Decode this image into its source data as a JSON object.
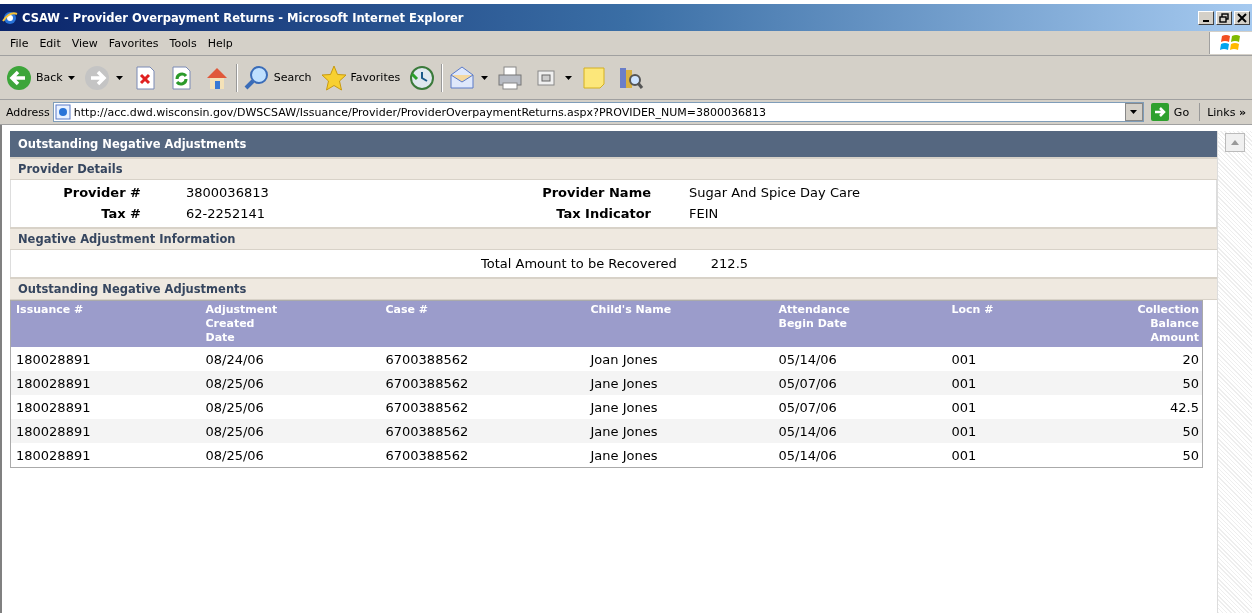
{
  "window": {
    "title": "CSAW - Provider Overpayment Returns - Microsoft Internet Explorer"
  },
  "menu": [
    "File",
    "Edit",
    "View",
    "Favorites",
    "Tools",
    "Help"
  ],
  "toolbar": [
    {
      "kind": "back",
      "label": "Back",
      "dropdown": true
    },
    {
      "kind": "forward",
      "dropdown": true
    },
    {
      "kind": "stop"
    },
    {
      "kind": "refresh"
    },
    {
      "kind": "home",
      "separator_after": true
    },
    {
      "kind": "search",
      "label": "Search"
    },
    {
      "kind": "favorites",
      "label": "Favorites"
    },
    {
      "kind": "history",
      "separator_after": true
    },
    {
      "kind": "mail",
      "dropdown": true
    },
    {
      "kind": "print"
    },
    {
      "kind": "edit",
      "dropdown": true
    },
    {
      "kind": "note"
    },
    {
      "kind": "research"
    }
  ],
  "address": {
    "label": "Address",
    "value": "http://acc.dwd.wisconsin.gov/DWSCSAW/Issuance/Provider/ProviderOverpaymentReturns.aspx?PROVIDER_NUM=3800036813",
    "go": "Go",
    "links": "Links",
    "links_more": "»"
  },
  "page": {
    "title": "Outstanding Negative Adjustments",
    "provider_details": {
      "heading": "Provider Details",
      "fields": [
        {
          "label": "Provider #",
          "value": "3800036813"
        },
        {
          "label": "Provider Name",
          "value": "Sugar And Spice Day Care"
        },
        {
          "label": "Tax #",
          "value": "62-2252141"
        },
        {
          "label": "Tax Indicator",
          "value": "FEIN"
        }
      ]
    },
    "adjustment_info": {
      "heading": "Negative Adjustment Information",
      "label": "Total Amount to be Recovered",
      "value": "212.5"
    },
    "table": {
      "heading": "Outstanding Negative Adjustments",
      "columns": [
        {
          "lines": [
            "Issuance #"
          ]
        },
        {
          "lines": [
            "Adjustment",
            "Created",
            "Date"
          ]
        },
        {
          "lines": [
            "Case #"
          ]
        },
        {
          "lines": [
            "Child's Name"
          ]
        },
        {
          "lines": [
            "Attendance",
            "Begin Date"
          ]
        },
        {
          "lines": [
            "Locn #"
          ]
        },
        {
          "lines": [
            "Collection",
            "Balance",
            "Amount"
          ]
        }
      ],
      "rows": [
        [
          "180028891",
          "08/24/06",
          "6700388562",
          "Joan Jones",
          "05/14/06",
          "001",
          "20"
        ],
        [
          "180028891",
          "08/25/06",
          "6700388562",
          "Jane Jones",
          "05/07/06",
          "001",
          "50"
        ],
        [
          "180028891",
          "08/25/06",
          "6700388562",
          "Jane Jones",
          "05/07/06",
          "001",
          "42.5"
        ],
        [
          "180028891",
          "08/25/06",
          "6700388562",
          "Jane Jones",
          "05/14/06",
          "001",
          "50"
        ],
        [
          "180028891",
          "08/25/06",
          "6700388562",
          "Jane Jones",
          "05/14/06",
          "001",
          "50"
        ]
      ]
    }
  }
}
